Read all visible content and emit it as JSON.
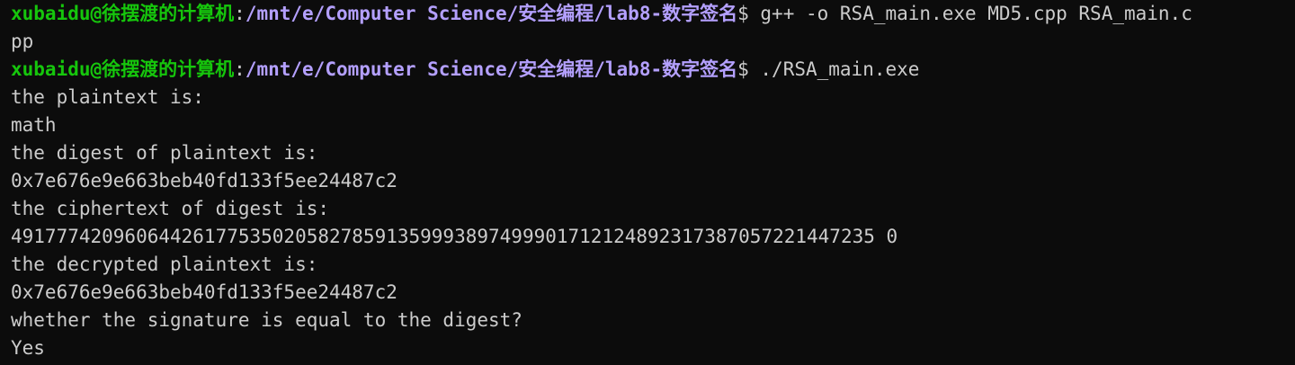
{
  "colors": {
    "background": "#0c0c0c",
    "foreground": "#cccccc",
    "prompt_user": "#16c60c",
    "prompt_path": "#b4a0ff"
  },
  "session": {
    "prompt1": {
      "user_host": "xubaidu@徐摆渡的计算机",
      "colon": ":",
      "path": "/mnt/e/Computer Science/安全编程/lab8-数字签名",
      "symbol": "$ ",
      "command": "g++ -o RSA_main.exe MD5.cpp RSA_main.c"
    },
    "wrap1": "pp",
    "prompt2": {
      "user_host": "xubaidu@徐摆渡的计算机",
      "colon": ":",
      "path": "/mnt/e/Computer Science/安全编程/lab8-数字签名",
      "symbol": "$ ",
      "command": "./RSA_main.exe"
    },
    "output": [
      "the plaintext is:",
      "math",
      "the digest of plaintext is:",
      "0x7e676e9e663beb40fd133f5ee24487c2",
      "the ciphertext of digest is:",
      "4917774209606442617753502058278591359993897499901712124892317387057221447235 0",
      "the decrypted plaintext is:",
      "0x7e676e9e663beb40fd133f5ee24487c2",
      "whether the signature is equal to the digest?",
      "Yes"
    ]
  }
}
